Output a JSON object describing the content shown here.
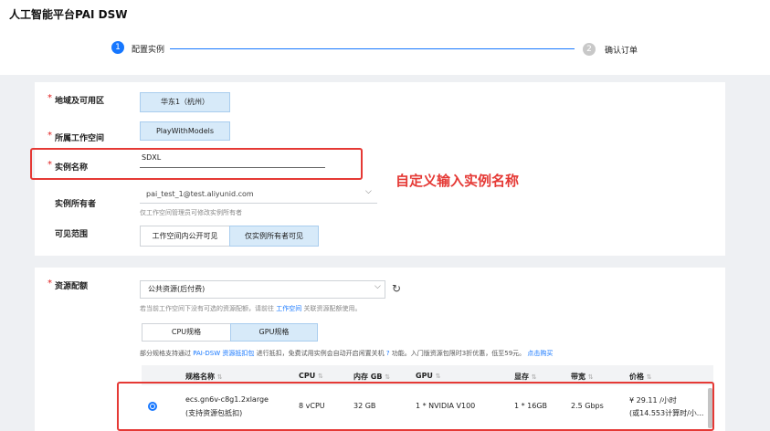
{
  "app": {
    "title": "人工智能平台PAI DSW"
  },
  "steps": [
    {
      "num": "1",
      "label": "配置实例"
    },
    {
      "num": "2",
      "label": "确认订单"
    }
  ],
  "form": {
    "region": {
      "label": "地域及可用区",
      "value": "华东1（杭州）"
    },
    "workspace": {
      "label": "所属工作空间",
      "value": "PlayWithModels"
    },
    "instance_name": {
      "label": "实例名称",
      "value": "SDXL"
    },
    "owner": {
      "label": "实例所有者",
      "value": "pai_test_1@test.aliyunid.com",
      "hint": "仅工作空间管理员可修改实例所有者"
    },
    "visibility": {
      "label": "可见范围",
      "options": [
        "工作空间内公开可见",
        "仅实例所有者可见"
      ],
      "selected": 1
    }
  },
  "annotation": "自定义输入实例名称",
  "resource": {
    "label": "资源配额",
    "select_value": "公共资源(后付费)",
    "hint_prefix": "若当前工作空间下没有可选的资源配额，请前往",
    "hint_link": "工作空间",
    "hint_suffix": "关联资源配额使用。",
    "tabs": [
      "CPU规格",
      "GPU规格"
    ],
    "selected_tab": 1,
    "notice_prefix": "部分规格支持通过",
    "notice_link": "PAI-DSW 资源抵扣包",
    "notice_mid": "进行抵扣，免费试用实例会自动开启闲置关机",
    "notice_mid2": "功能。入门版资源包限时3折优惠，低至59元。",
    "notice_link2": "点击购买",
    "table": {
      "headers": [
        "规格名称",
        "CPU",
        "内存 GB",
        "GPU",
        "显存",
        "带宽",
        "价格"
      ],
      "row": {
        "name": "ecs.gn6v-c8g1.2xlarge",
        "name_sub": "(支持资源包抵扣)",
        "cpu": "8 vCPU",
        "mem": "32 GB",
        "gpu": "1 * NVIDIA V100",
        "vram": "1 * 16GB",
        "bandwidth": "2.5 Gbps",
        "price": "¥ 29.11 /小时",
        "price_sub": "(或14.553计算时/小..."
      }
    }
  }
}
